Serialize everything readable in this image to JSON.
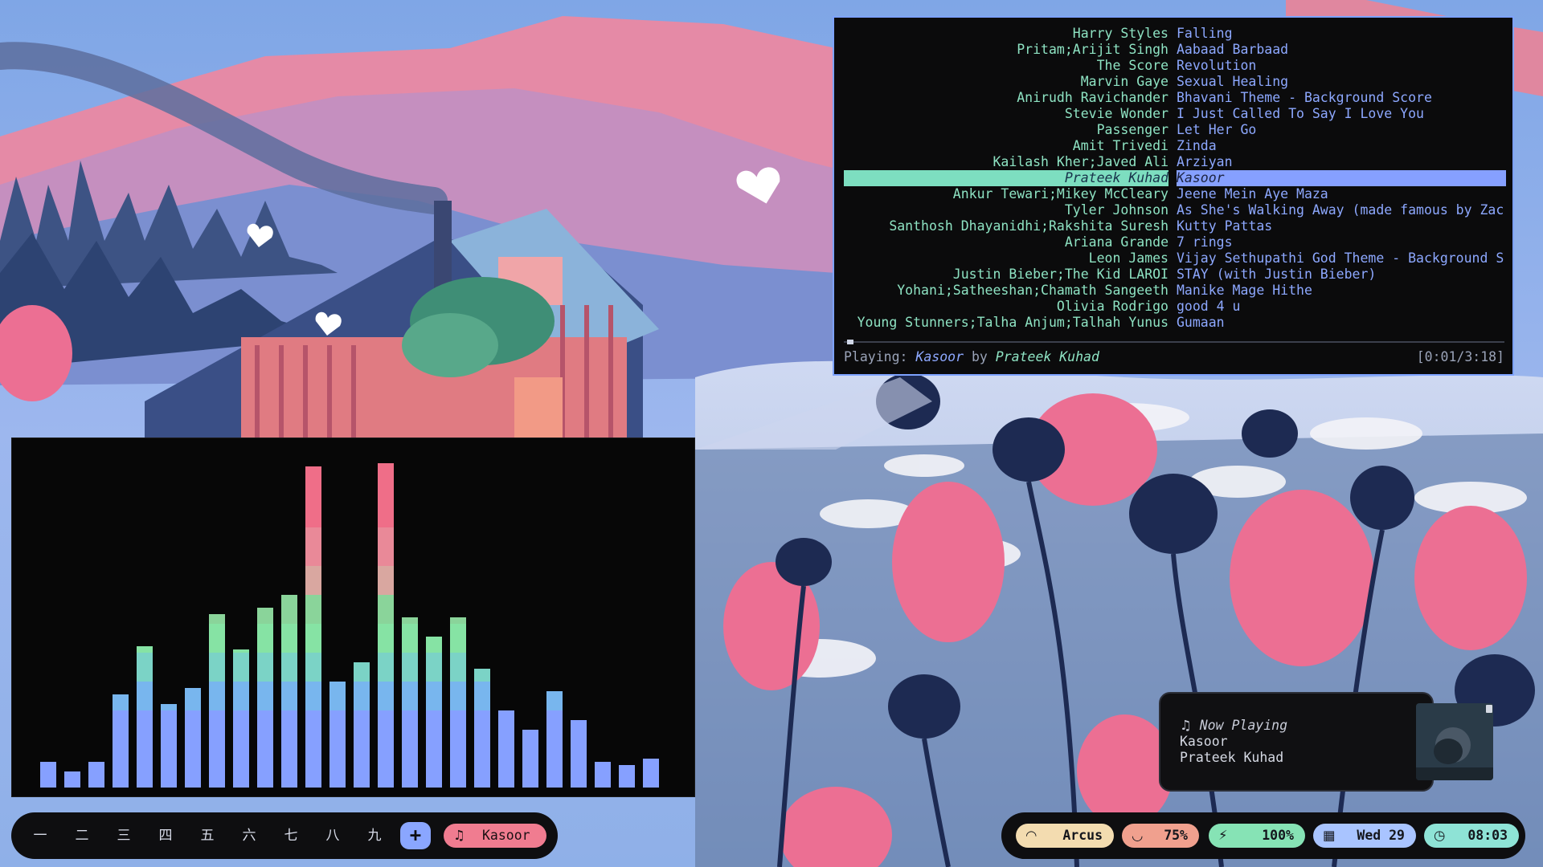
{
  "playlist": {
    "rows": [
      {
        "artist": "Harry Styles",
        "title": "Falling"
      },
      {
        "artist": "Pritam;Arijit Singh",
        "title": "Aabaad Barbaad"
      },
      {
        "artist": "The Score",
        "title": "Revolution"
      },
      {
        "artist": "Marvin Gaye",
        "title": "Sexual Healing"
      },
      {
        "artist": "Anirudh Ravichander",
        "title": "Bhavani Theme - Background Score"
      },
      {
        "artist": "Stevie Wonder",
        "title": "I Just Called To Say I Love You"
      },
      {
        "artist": "Passenger",
        "title": "Let Her Go"
      },
      {
        "artist": "Amit Trivedi",
        "title": "Zinda"
      },
      {
        "artist": "Kailash Kher;Javed Ali",
        "title": "Arziyan"
      },
      {
        "artist": "Prateek Kuhad",
        "title": "Kasoor"
      },
      {
        "artist": "Ankur Tewari;Mikey McCleary",
        "title": "Jeene Mein Aye Maza"
      },
      {
        "artist": "Tyler Johnson",
        "title": "As She's Walking Away (made famous by Zac"
      },
      {
        "artist": "Santhosh Dhayanidhi;Rakshita Suresh",
        "title": "Kutty Pattas"
      },
      {
        "artist": "Ariana Grande",
        "title": "7 rings"
      },
      {
        "artist": "Leon James",
        "title": "Vijay Sethupathi God Theme - Background S"
      },
      {
        "artist": "Justin Bieber;The Kid LAROI",
        "title": "STAY (with Justin Bieber)"
      },
      {
        "artist": "Yohani;Satheeshan;Chamath Sangeeth",
        "title": "Manike Mage Hithe"
      },
      {
        "artist": "Olivia Rodrigo",
        "title": "good 4 u"
      },
      {
        "artist": "Young Stunners;Talha Anjum;Talhah Yunus",
        "title": "Gumaan"
      }
    ],
    "selected_index": 9,
    "status_prefix": "Playing:",
    "status_song": "Kasoor",
    "status_by": "by",
    "status_artist": "Prateek Kuhad",
    "time": "[0:01/3:18]",
    "progress": 0.005
  },
  "visualizer": {
    "bars": [
      0.08,
      0.05,
      0.08,
      0.29,
      0.44,
      0.26,
      0.31,
      0.54,
      0.43,
      0.56,
      0.6,
      1.0,
      0.33,
      0.39,
      1.01,
      0.53,
      0.47,
      0.53,
      0.37,
      0.24,
      0.18,
      0.3,
      0.21,
      0.08,
      0.07,
      0.09
    ]
  },
  "workspaces": {
    "items": [
      "一",
      "二",
      "三",
      "四",
      "五",
      "六",
      "七",
      "八",
      "九"
    ],
    "add_label": "+",
    "music_icon": "music-note-icon",
    "music_label": "Kasoor"
  },
  "statusbar": {
    "wifi": {
      "icon": "wifi-icon",
      "text": "Arcus",
      "color": "#f3dcb0"
    },
    "volume": {
      "icon": "headphones-icon",
      "text": "75%",
      "color": "#f0a08e"
    },
    "battery": {
      "icon": "charging-plug-icon",
      "text": "100%",
      "color": "#86e3b5"
    },
    "date": {
      "icon": "calendar-icon",
      "text": "Wed 29",
      "color": "#a9c4ff"
    },
    "clock": {
      "icon": "clock-icon",
      "text": "08:03",
      "color": "#8ee3d6"
    }
  },
  "notification": {
    "header": "Now Playing",
    "title": "Kasoor",
    "artist": "Prateek Kuhad"
  },
  "colors": {
    "accent_blue": "#86a0ff",
    "accent_green": "#7ddec0",
    "accent_pink": "#f07c90"
  }
}
